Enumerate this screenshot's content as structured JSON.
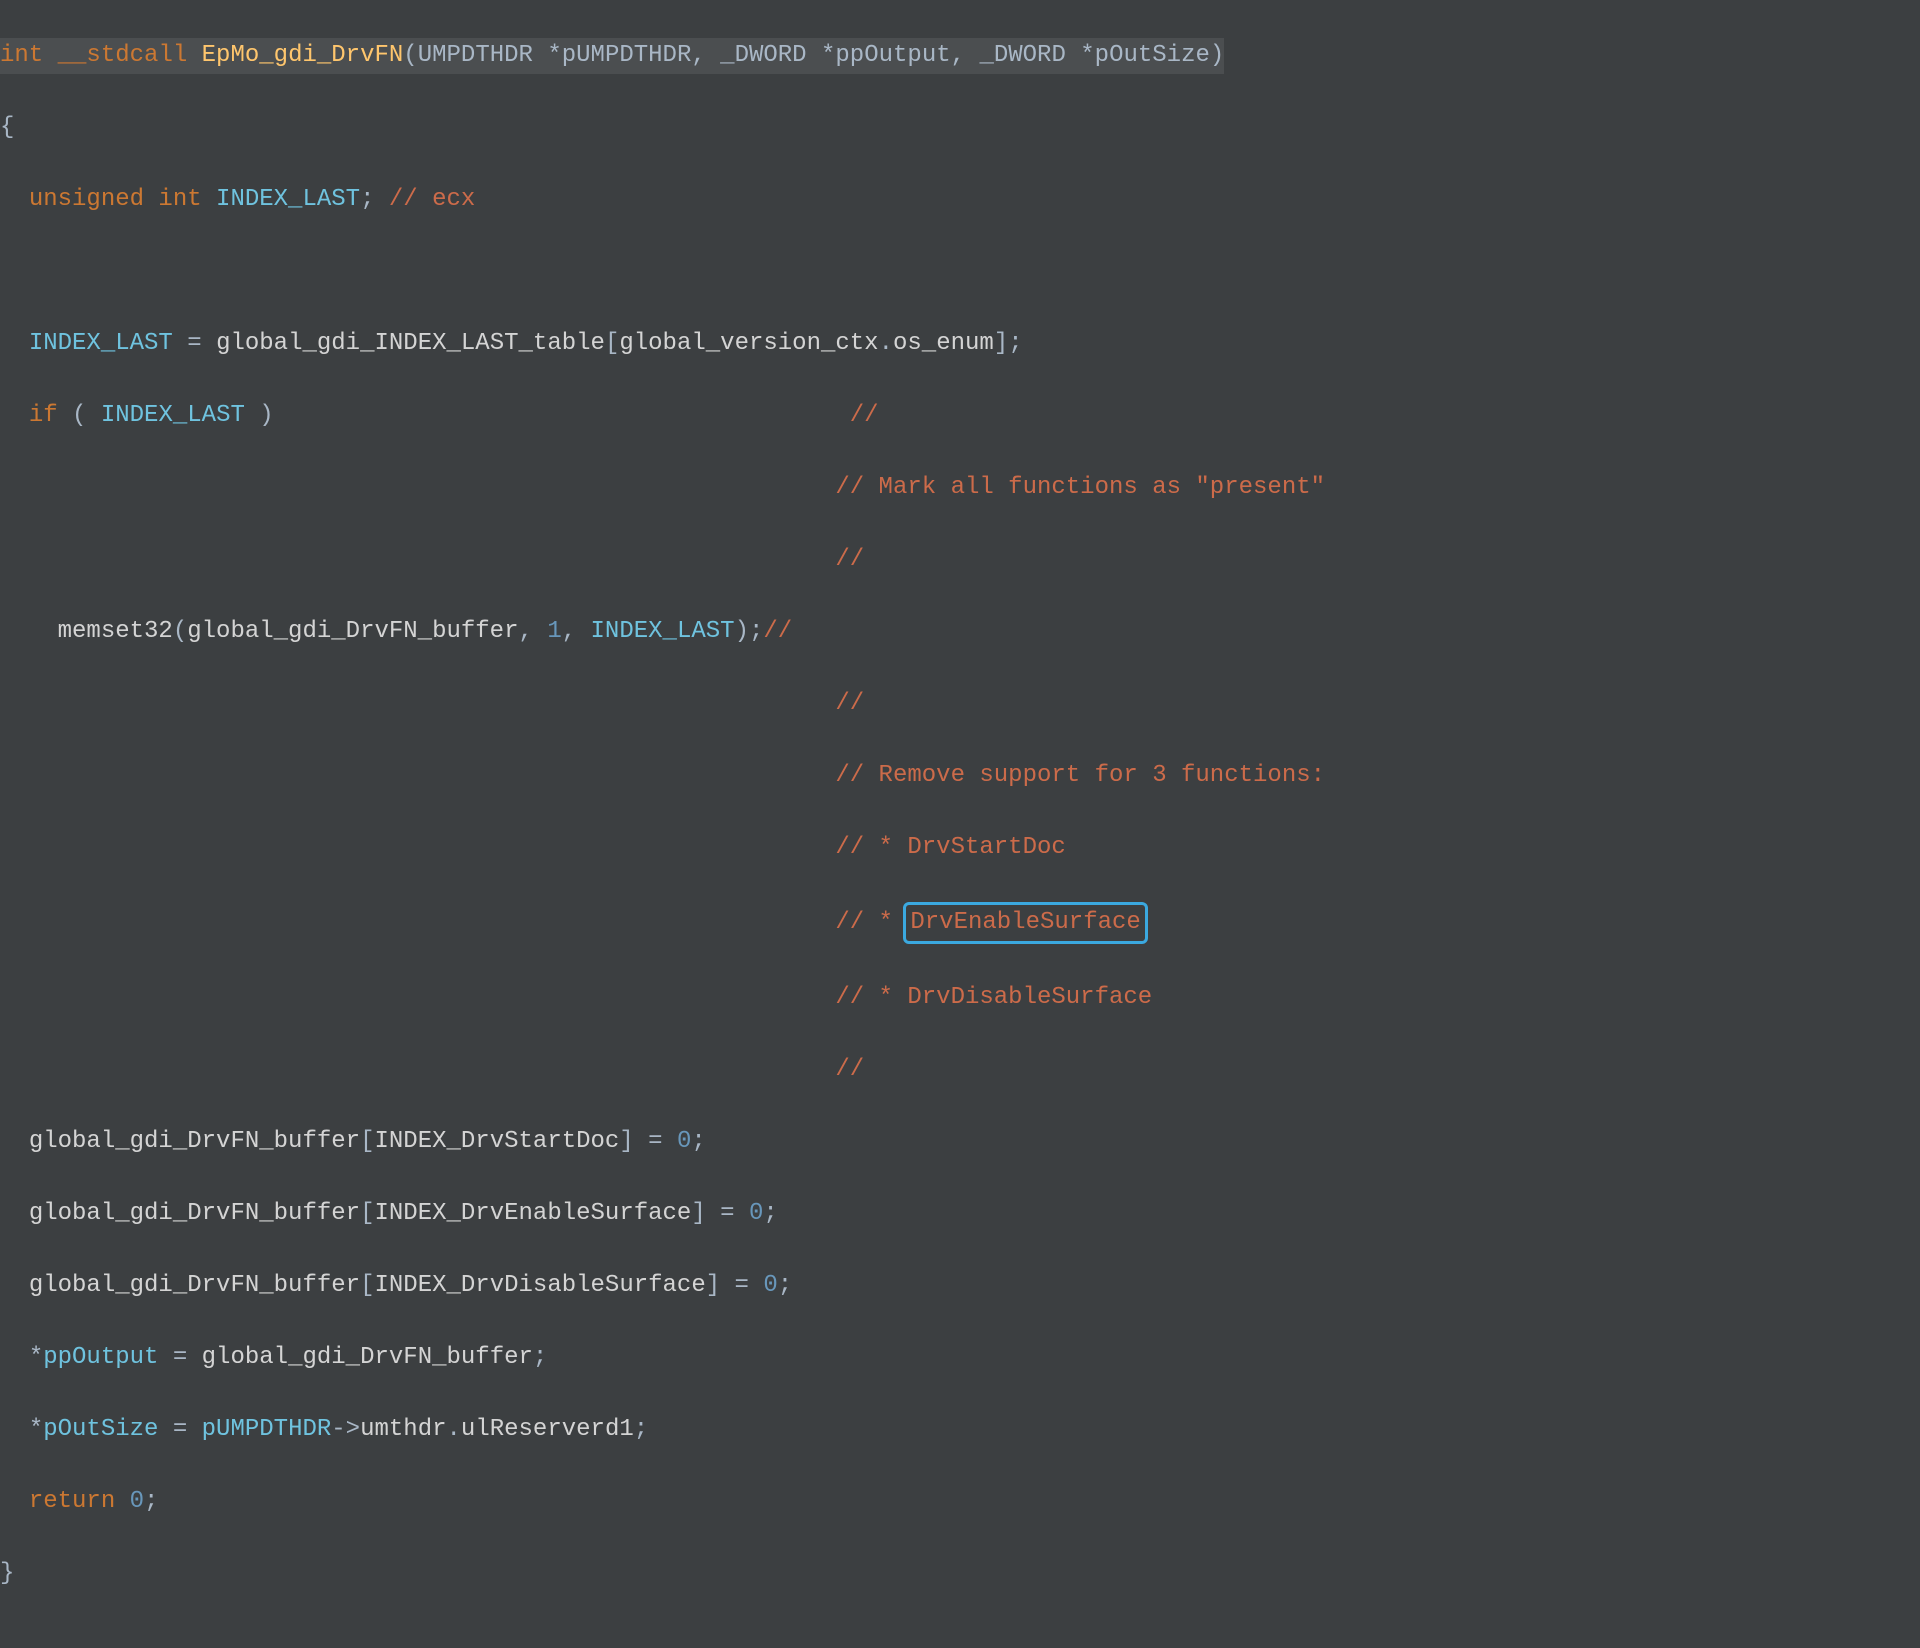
{
  "sig": {
    "ret": "int",
    "cc": "__stdcall",
    "fn": "EpMo_gdi_DrvFN",
    "p1_type": "UMPDTHDR",
    "p1_star": "*",
    "p1_name": "pUMPDTHDR",
    "p2_type": "_DWORD",
    "p2_star": "*",
    "p2_name": "ppOutput",
    "p3_type": "_DWORD",
    "p3_star": "*",
    "p3_name": "pOutSize"
  },
  "body": {
    "l1_open": "{",
    "decl_kw": "unsigned int",
    "decl_name": "INDEX_LAST",
    "decl_semi": ";",
    "decl_comment": "// ecx",
    "asg1_lhs": "INDEX_LAST",
    "asg1_eq": " = ",
    "asg1_rhs_fn": "global_gdi_INDEX_LAST_table",
    "asg1_rhs_idx1": "global_version_ctx",
    "asg1_rhs_dot": ".",
    "asg1_rhs_idx2": "os_enum",
    "asg1_rhs_end": "];",
    "if_kw": "if",
    "if_cond": "INDEX_LAST",
    "cmt_slash": "//",
    "cmt_mark": "// Mark all functions as \"present\"",
    "memset_fn": "memset32",
    "memset_a1": "global_gdi_DrvFN_buffer",
    "memset_a2": "1",
    "memset_a3": "INDEX_LAST",
    "cmt_remove": "// Remove support for 3 functions:",
    "cmt_f1": "// * DrvStartDoc",
    "cmt_f2a": "// * ",
    "cmt_f2b": "DrvEnableSurface",
    "cmt_f3": "// * DrvDisableSurface",
    "buf": "global_gdi_DrvFN_buffer",
    "idx1": "INDEX_DrvStartDoc",
    "idx2": "INDEX_DrvEnableSurface",
    "idx3": "INDEX_DrvDisableSurface",
    "zero": "0",
    "out_lhs": "ppOutput",
    "out_rhs": "global_gdi_DrvFN_buffer",
    "sz_lhs": "pOutSize",
    "sz_rhs1": "pUMPDTHDR",
    "sz_arrow": "->",
    "sz_rhs2": "umthdr",
    "sz_rhs3": "ulReserverd1",
    "ret_kw": "return",
    "ret_val": "0",
    "l_close": "}"
  }
}
